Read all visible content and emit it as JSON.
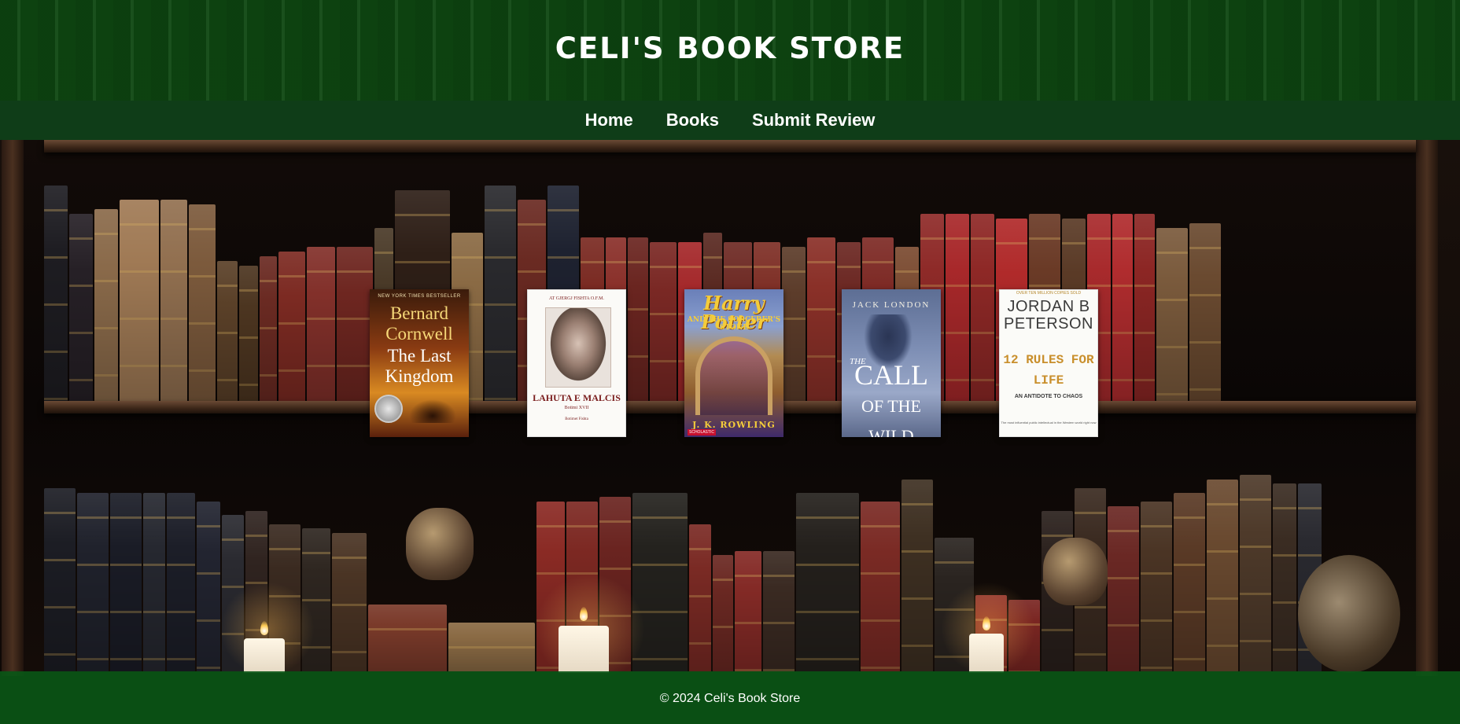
{
  "header": {
    "title": "CELI'S BOOK STORE"
  },
  "nav": {
    "items": [
      {
        "label": "Home"
      },
      {
        "label": "Books"
      },
      {
        "label": "Submit Review"
      }
    ]
  },
  "books": [
    {
      "top_line": "NEW YORK TIMES BESTSELLER",
      "author": "Bernard Cornwell",
      "title": "The Last Kingdom"
    },
    {
      "top_line": "AT GJERGJ FISHTA O.F.M.",
      "title": "LAHUTA E MALCIS",
      "subtitle": "Botimi XVII",
      "publisher": "Botimet Fishta"
    },
    {
      "title": "Harry Potter",
      "subtitle": "AND THE SORCERER'S STONE",
      "author": "J. K. ROWLING",
      "publisher": "SCHOLASTIC"
    },
    {
      "author": "JACK LONDON",
      "title_small": "THE",
      "title_line1": "CALL",
      "title_line2": "OF THE WILD"
    },
    {
      "top_line": "OVER TEN MILLION COPIES SOLD",
      "author": "JORDAN B PETERSON",
      "title": "12 RULES FOR LIFE",
      "subtitle": "AN ANTIDOTE TO CHAOS",
      "quote": "The most influential public intellectual in the Western world right now"
    }
  ],
  "footer": {
    "text": "© 2024 Celi's Book Store"
  },
  "colors": {
    "header_bg": "#0e4a12",
    "nav_bg": "#0f3d18",
    "footer_bg": "#0a5616",
    "text": "#ffffff"
  }
}
